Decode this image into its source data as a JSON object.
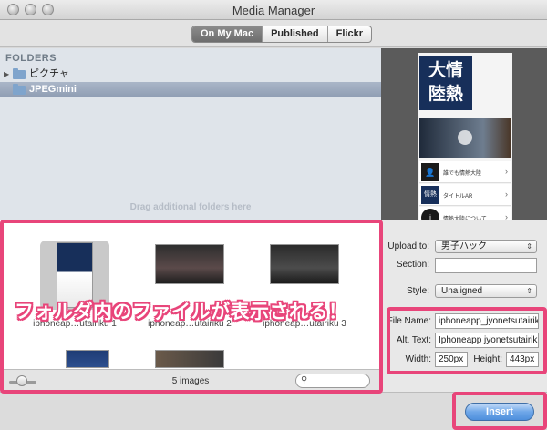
{
  "window": {
    "title": "Media Manager"
  },
  "tabs": [
    {
      "label": "On My Mac",
      "active": true
    },
    {
      "label": "Published",
      "active": false
    },
    {
      "label": "Flickr",
      "active": false
    }
  ],
  "folders": {
    "heading": "FOLDERS",
    "items": [
      {
        "label": "ピクチャ",
        "selected": false
      },
      {
        "label": "JPEGmini",
        "selected": true
      }
    ],
    "drag_hint": "Drag additional folders here"
  },
  "preview": {
    "logo_text": "大情陸熱",
    "rows": [
      {
        "icon": "person-icon",
        "text": "誰でも情熱大陸"
      },
      {
        "icon": "logo-icon",
        "text": "タイトルAR"
      },
      {
        "icon": "info-icon",
        "text": "情熱大陸について"
      }
    ]
  },
  "images": {
    "items": [
      {
        "caption": "iphoneap…utairiku 1",
        "selected": true
      },
      {
        "caption": "iphoneap…utairiku 2",
        "selected": false
      },
      {
        "caption": "iphoneap…utairiku 3",
        "selected": false
      },
      {
        "caption": "",
        "selected": false
      },
      {
        "caption": "",
        "selected": false
      }
    ],
    "count_label": "5 images",
    "overlay_text": "フォルダ内のファイルが表示される！"
  },
  "details": {
    "upload_to_label": "Upload to:",
    "upload_to_value": "男子ハック",
    "section_label": "Section:",
    "section_value": "",
    "style_label": "Style:",
    "style_value": "Unaligned",
    "file_name_label": "File Name:",
    "file_name_value": "iphoneapp_jyonetsutairiku",
    "alt_text_label": "Alt. Text:",
    "alt_text_value": "Iphoneapp jyonetsutairiku",
    "width_label": "Width:",
    "width_value": "250px",
    "height_label": "Height:",
    "height_value": "443px"
  },
  "footer": {
    "insert_label": "Insert"
  },
  "colors": {
    "highlight": "#e8457a",
    "accent_button": "#4e8fdc",
    "selection": "#8f9db3"
  }
}
